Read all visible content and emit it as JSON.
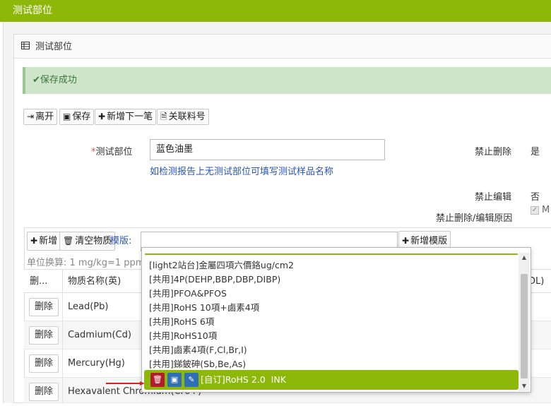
{
  "window_title": "测试部位",
  "panel_title": "测试部位",
  "alert": "保存成功",
  "toolbar": {
    "leave": "离开",
    "save": "保存",
    "add_next": "新增下一笔",
    "related_part_no": "关联料号"
  },
  "form": {
    "part_label": "测试部位",
    "part_value": "蓝色油墨",
    "part_hint": "如检测报告上无测试部位可填写测试样品名称",
    "no_delete_label": "禁止删除",
    "no_delete_value": "是",
    "no_edit_label": "禁止编辑",
    "no_edit_value": "否",
    "reason_label": "禁止删除/编辑原因",
    "reason_checkbox_text": "M"
  },
  "material_toolbar": {
    "add": "新增",
    "clear": "清空物质",
    "template_label": "模版:",
    "template_value": "",
    "add_template": "新增模版"
  },
  "unit_note": "单位换算: 1 mg/kg=1 ppm;",
  "table": {
    "headers": {
      "delete": "删...",
      "name_en": "物质名称(英)",
      "dl": "DL)"
    },
    "rows": [
      {
        "delete": "删除",
        "name": "Lead(Pb)"
      },
      {
        "delete": "删除",
        "name": "Cadmium(Cd)"
      },
      {
        "delete": "删除",
        "name": "Mercury(Hg)"
      },
      {
        "delete": "删除",
        "name": "Hexavalent Chromium(Cr6+)"
      }
    ]
  },
  "template_dropdown": {
    "items": [
      "[light2站台]金屬四項六價鉻ug/cm2",
      "[共用]4P(DEHP,BBP,DBP,DIBP)",
      "[共用]PFOA&PFOS",
      "[共用]RoHS 10項+鹵素4項",
      "[共用]RoHS 6項",
      "[共用]RoHS10項",
      "[共用]鹵素4項(F,Cl,Br,I)",
      "[共用]銻鈹砷(Sb,Be,As)"
    ],
    "selected": "[自订]RoHS 2.0  INK"
  },
  "colors": {
    "accent": "#8db80a",
    "alert_bg": "#cfe5c9",
    "alert_text": "#3c763d",
    "hint": "#2a55b8",
    "danger": "#b22222",
    "save_blue": "#2f6fb5",
    "annotation_arrow": "#e31c1c"
  }
}
